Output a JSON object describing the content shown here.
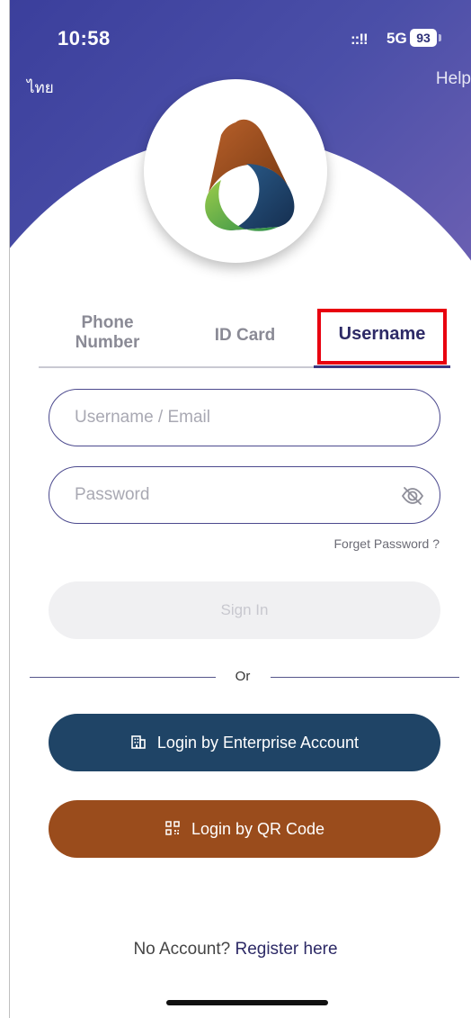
{
  "status": {
    "time": "10:58",
    "signal": "::!!",
    "network": "5G",
    "battery": "93"
  },
  "header": {
    "language": "ไทย",
    "help": "Help"
  },
  "tabs": [
    {
      "label": "Phone Number",
      "active": false
    },
    {
      "label": "ID Card",
      "active": false
    },
    {
      "label": "Username",
      "active": true
    }
  ],
  "form": {
    "username_placeholder": "Username / Email",
    "username_value": "",
    "password_placeholder": "Password",
    "password_value": "",
    "forget_password": "Forget Password ?",
    "sign_in": "Sign In"
  },
  "divider_text": "Or",
  "alt_logins": {
    "enterprise": "Login by Enterprise Account",
    "qr": "Login by QR Code"
  },
  "footer": {
    "no_account": "No Account?",
    "register": "Register here"
  },
  "colors": {
    "header": "#3b3f9c",
    "primary_text": "#2d2a66",
    "enterprise_button": "#1f4466",
    "qr_button": "#9a4c1c",
    "highlight": "#e8000f",
    "logo_brown": "#a0521f",
    "logo_green": "#6fb43b",
    "logo_blue": "#1e3f66"
  },
  "icons": {
    "eye": "eye-off-icon",
    "enterprise": "building-icon",
    "qr": "qr-code-icon"
  }
}
